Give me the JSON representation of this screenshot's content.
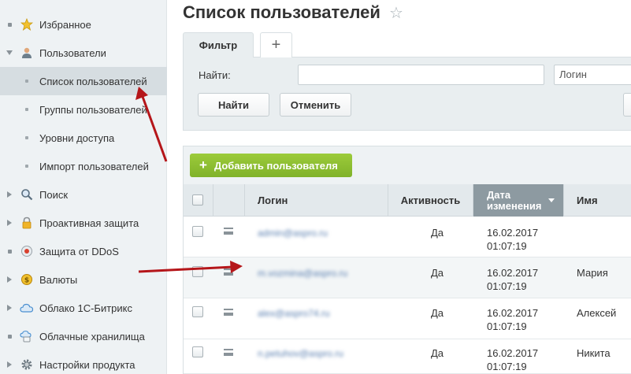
{
  "sidebar": {
    "items": [
      {
        "label": "Избранное",
        "icon": "star-icon",
        "marker": "bullet"
      },
      {
        "label": "Пользователи",
        "icon": "user-icon",
        "marker": "arrow-down"
      },
      {
        "label": "Список пользователей",
        "marker": "sub-bullet",
        "active": true
      },
      {
        "label": "Группы пользователей",
        "marker": "sub-bullet"
      },
      {
        "label": "Уровни доступа",
        "marker": "sub-bullet"
      },
      {
        "label": "Импорт пользователей",
        "marker": "sub-bullet"
      },
      {
        "label": "Поиск",
        "icon": "search-icon",
        "marker": "arrow-right"
      },
      {
        "label": "Проактивная защита",
        "icon": "lock-icon",
        "marker": "arrow-right"
      },
      {
        "label": "Защита от DDoS",
        "icon": "shield-icon",
        "marker": "bullet"
      },
      {
        "label": "Валюты",
        "icon": "coin-icon",
        "marker": "arrow-right"
      },
      {
        "label": "Облако 1С-Битрикс",
        "icon": "cloud-icon",
        "marker": "arrow-right"
      },
      {
        "label": "Облачные хранилища",
        "icon": "cloud-storage-icon",
        "marker": "bullet"
      },
      {
        "label": "Настройки продукта",
        "icon": "gear-icon",
        "marker": "arrow-right"
      }
    ]
  },
  "page": {
    "title": "Список пользователей"
  },
  "filter": {
    "tab_label": "Фильтр",
    "add_tab": "+",
    "find_label": "Найти:",
    "find_value": "",
    "select_value": "Логин",
    "find_button": "Найти",
    "cancel_button": "Отменить"
  },
  "grid": {
    "add_button": "Добавить пользователя",
    "add_plus": "+",
    "columns": {
      "login": "Логин",
      "active": "Активность",
      "date_line1": "Дата",
      "date_line2": "изменения",
      "name": "Имя"
    },
    "rows": [
      {
        "login": "admin@aspro.ru",
        "active": "Да",
        "date": "16.02.2017",
        "time": "01:07:19",
        "name": ""
      },
      {
        "login": "m.vozmina@aspro.ru",
        "active": "Да",
        "date": "16.02.2017",
        "time": "01:07:19",
        "name": "Мария"
      },
      {
        "login": "alex@aspro74.ru",
        "active": "Да",
        "date": "16.02.2017",
        "time": "01:07:19",
        "name": "Алексей"
      },
      {
        "login": "n.petuhov@aspro.ru",
        "active": "Да",
        "date": "16.02.2017",
        "time": "01:07:19",
        "name": "Никита"
      }
    ]
  },
  "colors": {
    "annotation_arrow": "#b5161a",
    "add_button_green": "#8cbf30",
    "sorted_header": "#8d9aa1"
  }
}
